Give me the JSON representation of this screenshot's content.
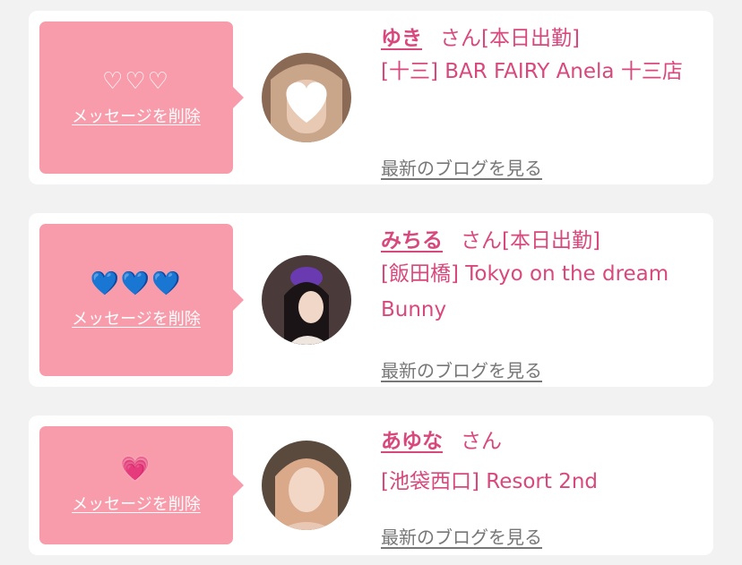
{
  "favorites": [
    {
      "icon": "♡♡♡",
      "icon_name": "outline-hearts-icon",
      "delete_label": "メッセージを削除",
      "name": "ゆき",
      "honorific": "さん",
      "status": "[本日出勤]",
      "shop": "[十三] BAR FAIRY Anela 十三店",
      "blog_link": "最新のブログを見る"
    },
    {
      "icon": "💙💙💙",
      "icon_name": "blue-hearts-icon",
      "delete_label": "メッセージを削除",
      "name": "みちる",
      "honorific": "さん",
      "status": "[本日出勤]",
      "shop": "[飯田橋] Tokyo on the dream Bunny",
      "blog_link": "最新のブログを見る"
    },
    {
      "icon": "💗",
      "icon_name": "pink-heart-icon",
      "delete_label": "メッセージを削除",
      "name": "あゆな",
      "honorific": "さん",
      "status": "",
      "shop": "[池袋西口] Resort 2nd",
      "blog_link": "最新のブログを見る"
    }
  ],
  "colors": {
    "accent": "#d9487c",
    "bubble": "#f89cab",
    "background": "#f2f2f2",
    "card": "#ffffff",
    "link_gray": "#777777"
  }
}
